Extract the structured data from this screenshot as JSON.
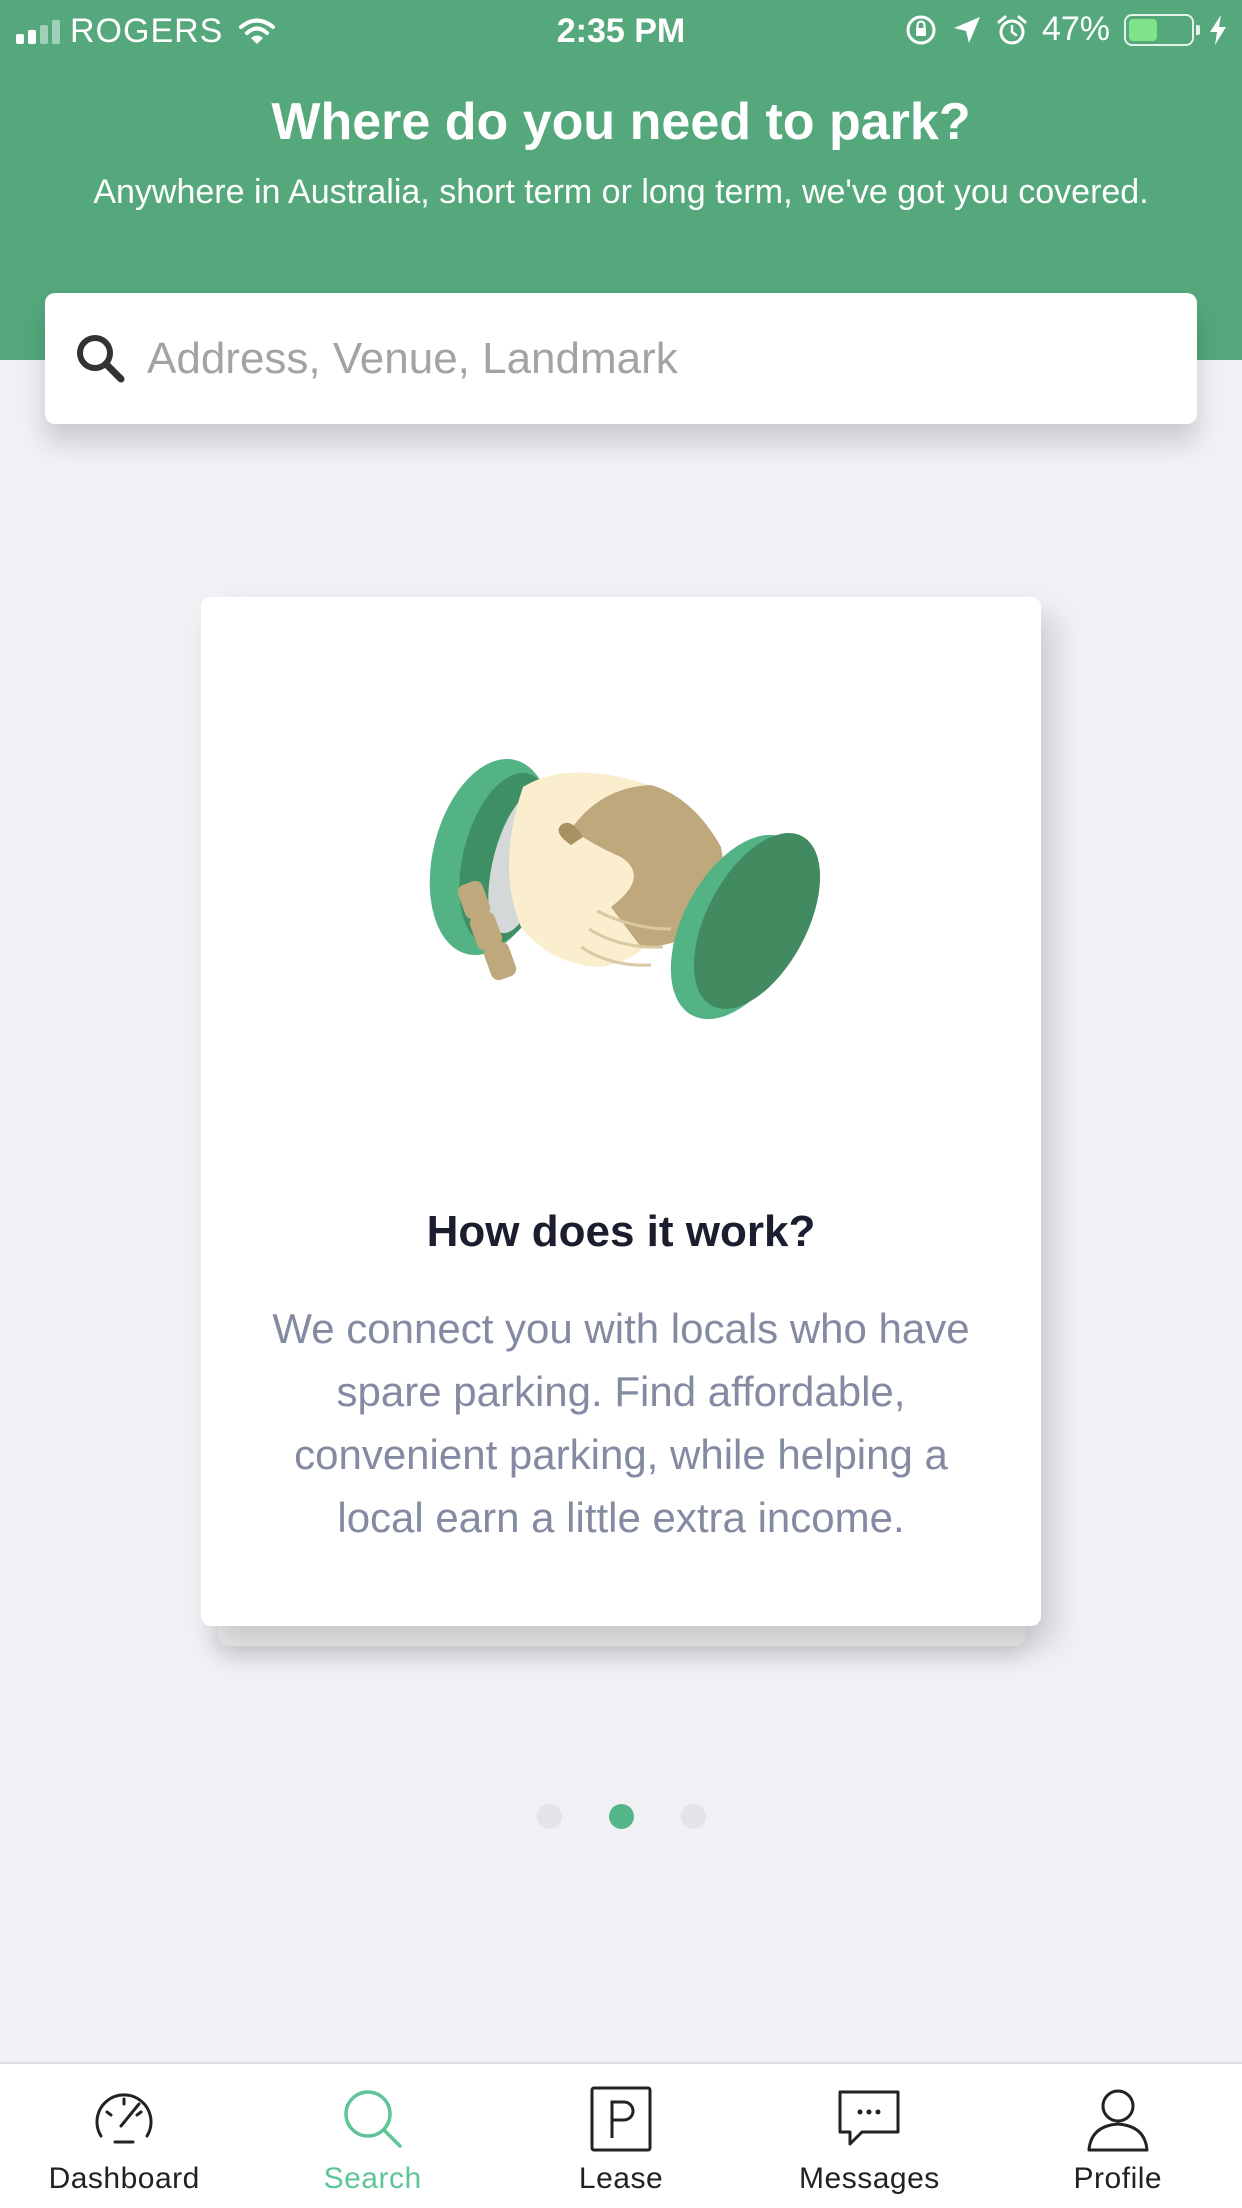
{
  "status_bar": {
    "carrier": "ROGERS",
    "time": "2:35 PM",
    "battery_percent": "47%",
    "battery_level": 0.47
  },
  "header": {
    "title": "Where do you need to park?",
    "subtitle": "Anywhere in Australia, short term or long term, we've got you covered."
  },
  "search": {
    "placeholder": "Address, Venue, Landmark",
    "value": ""
  },
  "card": {
    "illustration": "handshake",
    "title": "How does it work?",
    "body": "We connect you with locals who have spare parking. Find affordable, convenient parking, while helping a local earn a little extra income."
  },
  "pager": {
    "count": 3,
    "active_index": 1
  },
  "tabs": [
    {
      "label": "Dashboard",
      "icon": "speedometer-icon",
      "active": false
    },
    {
      "label": "Search",
      "icon": "search-icon",
      "active": true
    },
    {
      "label": "Lease",
      "icon": "parking-icon",
      "active": false
    },
    {
      "label": "Messages",
      "icon": "chat-bubble-icon",
      "active": false
    },
    {
      "label": "Profile",
      "icon": "person-icon",
      "active": false
    }
  ],
  "colors": {
    "brand_green": "#54a87c",
    "active_tab": "#5fc496",
    "background": "#f0f1f5",
    "body_text": "#838aa1"
  }
}
